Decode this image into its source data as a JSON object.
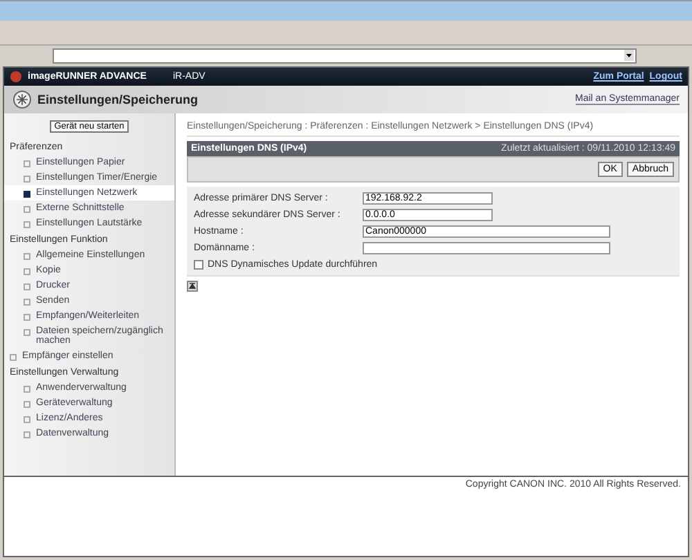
{
  "header": {
    "product": "imageRUNNER ADVANCE",
    "model": "iR-ADV",
    "links": [
      "Zum Portal",
      "Logout"
    ]
  },
  "title_bar": {
    "title": "Einstellungen/Speicherung",
    "mail_link": "Mail an Systemmanager"
  },
  "sidebar": {
    "restart_button": "Gerät neu starten",
    "items": [
      {
        "kind": "group",
        "label": "Präferenzen",
        "children": [
          {
            "label": "Einstellungen Papier",
            "selected": false
          },
          {
            "label": "Einstellungen Timer/Energie",
            "selected": false
          },
          {
            "label": "Einstellungen Netzwerk",
            "selected": true
          },
          {
            "label": "Externe Schnittstelle",
            "selected": false
          },
          {
            "label": "Einstellungen Lautstärke",
            "selected": false
          }
        ]
      },
      {
        "kind": "group",
        "label": "Einstellungen Funktion",
        "children": [
          {
            "label": "Allgemeine Einstellungen",
            "selected": false
          },
          {
            "label": "Kopie",
            "selected": false
          },
          {
            "label": "Drucker",
            "selected": false
          },
          {
            "label": "Senden",
            "selected": false
          },
          {
            "label": "Empfangen/Weiterleiten",
            "selected": false
          },
          {
            "label": "Dateien speichern/zugänglich machen",
            "selected": false
          }
        ]
      },
      {
        "kind": "link",
        "label": "Empfänger einstellen",
        "selected": false
      },
      {
        "kind": "group",
        "label": "Einstellungen Verwaltung",
        "children": [
          {
            "label": "Anwenderverwaltung",
            "selected": false
          },
          {
            "label": "Geräteverwaltung",
            "selected": false
          },
          {
            "label": "Lizenz/Anderes",
            "selected": false
          },
          {
            "label": "Datenverwaltung",
            "selected": false
          }
        ]
      }
    ]
  },
  "breadcrumb": "Einstellungen/Speicherung : Präferenzen : Einstellungen Netzwerk > Einstellungen DNS (IPv4)",
  "panel": {
    "title": "Einstellungen DNS (IPv4)",
    "updated": "Zuletzt aktualisiert : 09/11.2010 12:13:49",
    "buttons": [
      "OK",
      "Abbruch"
    ]
  },
  "fields": [
    {
      "label": "Adresse primärer DNS Server :",
      "value": "192.168.92.2",
      "kind": "short"
    },
    {
      "label": "Adresse sekundärer DNS Server :",
      "value": "0.0.0.0",
      "kind": "short"
    },
    {
      "label": "Hostname :",
      "value": "Canon000000",
      "kind": "long"
    },
    {
      "label": "Domänname :",
      "kind": "long"
    }
  ],
  "checkbox": {
    "label": "DNS Dynamisches Update durchführen",
    "checked": false
  },
  "copyright": "Copyright CANON INC. 2010 All Rights Reserved."
}
